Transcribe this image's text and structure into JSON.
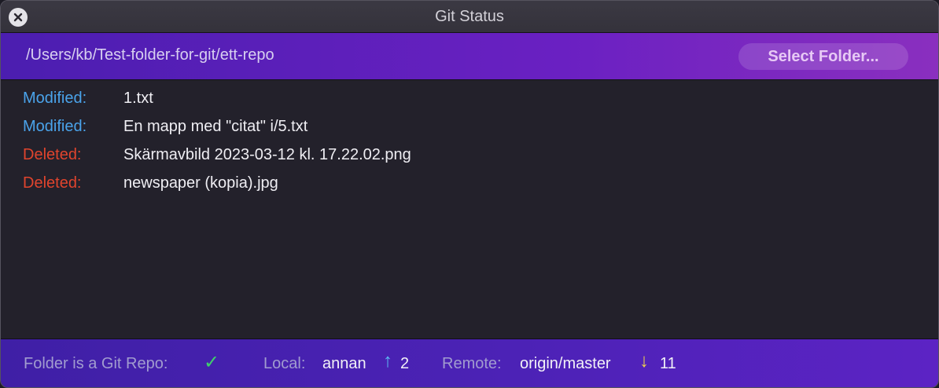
{
  "window": {
    "title": "Git Status"
  },
  "pathbar": {
    "path": "/Users/kb/Test-folder-for-git/ett-repo",
    "select_button": "Select Folder..."
  },
  "files": [
    {
      "status": "Modified:",
      "name": "1.txt"
    },
    {
      "status": "Modified:",
      "name": "En mapp med \"citat\" i/5.txt"
    },
    {
      "status": "Deleted:",
      "name": "Skärmavbild 2023-03-12 kl. 17.22.02.png"
    },
    {
      "status": "Deleted:",
      "name": "newspaper (kopia).jpg"
    }
  ],
  "footer": {
    "repo_label": "Folder is a Git Repo:",
    "repo_check": "✓",
    "local_label": "Local:",
    "local_branch": "annan",
    "ahead_icon": "↑",
    "ahead_count": "2",
    "remote_label": "Remote:",
    "remote_branch": "origin/master",
    "behind_icon": "↓",
    "behind_count": "11"
  },
  "colors": {
    "modified": "#4aa3ea",
    "deleted": "#e0442d",
    "check": "#3fd06b",
    "ahead": "#5bb7f2",
    "behind": "#f2d54a"
  }
}
